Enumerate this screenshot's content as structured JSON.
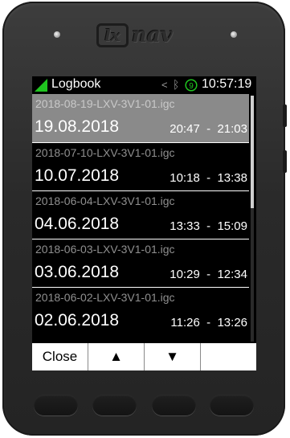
{
  "device": {
    "logo_box_text": "lx",
    "logo_text": "nav",
    "hardware_buttons": [
      "",
      "",
      "",
      ""
    ]
  },
  "status_bar": {
    "title": "Logbook",
    "satellite_count": "9",
    "time": "10:57:19",
    "icons": [
      "signal-icon",
      "navigation-icon",
      "bluetooth-icon",
      "satellite-icon"
    ],
    "accent_color": "#1fc51f"
  },
  "logbook": {
    "entries": [
      {
        "file": "2018-08-19-LXV-3V1-01.igc",
        "date": "19.08.2018",
        "time_range": "20:47  -  21:03",
        "selected": true
      },
      {
        "file": "2018-07-10-LXV-3V1-01.igc",
        "date": "10.07.2018",
        "time_range": "10:18  -  13:38",
        "selected": false
      },
      {
        "file": "2018-06-04-LXV-3V1-01.igc",
        "date": "04.06.2018",
        "time_range": "13:33  -  15:09",
        "selected": false
      },
      {
        "file": "2018-06-03-LXV-3V1-01.igc",
        "date": "03.06.2018",
        "time_range": "10:29  -  12:34",
        "selected": false
      },
      {
        "file": "2018-06-02-LXV-3V1-01.igc",
        "date": "02.06.2018",
        "time_range": "11:26  -  13:26",
        "selected": false
      }
    ]
  },
  "softkeys": {
    "close": "Close",
    "up": "▲",
    "down": "▼",
    "empty": ""
  }
}
